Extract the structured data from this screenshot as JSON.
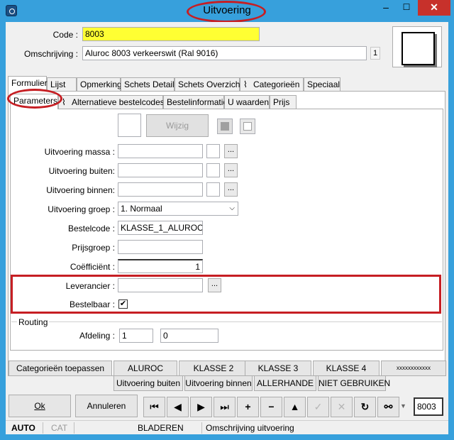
{
  "window": {
    "title": "Uitvoering",
    "min": "–",
    "max": "☐",
    "close": "✕"
  },
  "header": {
    "code_label": "Code :",
    "code_value": "8003",
    "desc_label": "Omschrijving :",
    "desc_value": "Aluroc 8003 verkeerswit (Ral 9016)",
    "desc_badge": "1"
  },
  "tabs": [
    "Formulier",
    "Lijst",
    "Opmerking",
    "Schets Detail",
    "Schets Overzicht",
    "Categorieën",
    "Speciaal"
  ],
  "subtabs": [
    "Parameters",
    "Alternatieve bestelcodes",
    "Bestelinformatie",
    "U waarden",
    "Prijs"
  ],
  "params": {
    "wijzig": "Wijzig",
    "massa_label": "Uitvoering massa :",
    "buiten_label": "Uitvoering buiten:",
    "binnen_label": "Uitvoering binnen:",
    "groep_label": "Uitvoering groep :",
    "groep_value": "1.  Normaal",
    "bestelcode_label": "Bestelcode :",
    "bestelcode_value": "KLASSE_1_ALUROC",
    "prijsgroep_label": "Prijsgroep :",
    "coef_label": "Coëfficiënt :",
    "coef_value": "1",
    "leverancier_label": "Leverancier :",
    "bestelbaar_label": "Bestelbaar :",
    "bestelbaar_checked": "✔",
    "dots": "..."
  },
  "routing": {
    "title": "Routing",
    "afdeling_label": "Afdeling :",
    "afdeling_1": "1",
    "afdeling_2": "0"
  },
  "actions_row1": [
    "Categorieën toepassen",
    "ALUROC",
    "KLASSE 2",
    "KLASSE 3",
    "KLASSE 4",
    "xxxxxxxxxxxx"
  ],
  "actions_row2": [
    "Uitvoering buiten",
    "Uitvoering binnen",
    "ALLERHANDE",
    "NIET GEBRUIKEN"
  ],
  "bottom": {
    "ok": "Ok",
    "annuleren": "Annuleren",
    "record_value": "8003"
  },
  "nav_icons": [
    "first-icon",
    "prev-icon",
    "next-icon",
    "last-icon",
    "plus-icon",
    "minus-icon",
    "up-icon",
    "check-icon",
    "cross-icon",
    "refresh-icon",
    "binoculars-icon",
    "dropdown-arrow-icon"
  ],
  "status": {
    "auto": "AUTO",
    "cat": "CAT",
    "mode": "BLADEREN",
    "info": "Omschrijving uitvoering"
  },
  "colors": {
    "titlebar": "#37a0dc",
    "code_highlight": "#ffff33",
    "annotation_red": "#c61e23",
    "close_button": "#c7312b"
  }
}
